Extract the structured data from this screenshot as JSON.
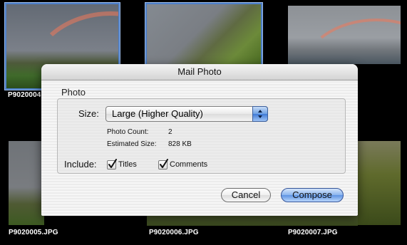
{
  "thumbnails": [
    {
      "caption": "P9020004.JPG",
      "selected": true
    },
    {
      "caption": "",
      "selected": true
    },
    {
      "caption": "",
      "selected": false
    },
    {
      "caption": "P9020005.JPG",
      "selected": false
    },
    {
      "caption": "P9020006.JPG",
      "selected": false
    },
    {
      "caption": "P9020007.JPG",
      "selected": false
    }
  ],
  "dialog": {
    "title": "Mail Photo",
    "group_label": "Photo",
    "size_label": "Size:",
    "size_value": "Large (Higher Quality)",
    "photo_count_label": "Photo Count:",
    "photo_count_value": "2",
    "estimated_size_label": "Estimated Size:",
    "estimated_size_value": "828 KB",
    "include_label": "Include:",
    "titles_label": "Titles",
    "titles_checked": true,
    "comments_label": "Comments",
    "comments_checked": true,
    "cancel_label": "Cancel",
    "compose_label": "Compose"
  },
  "icons": {
    "popup": "up-down-chevron-icon",
    "check": "checkmark-icon"
  }
}
